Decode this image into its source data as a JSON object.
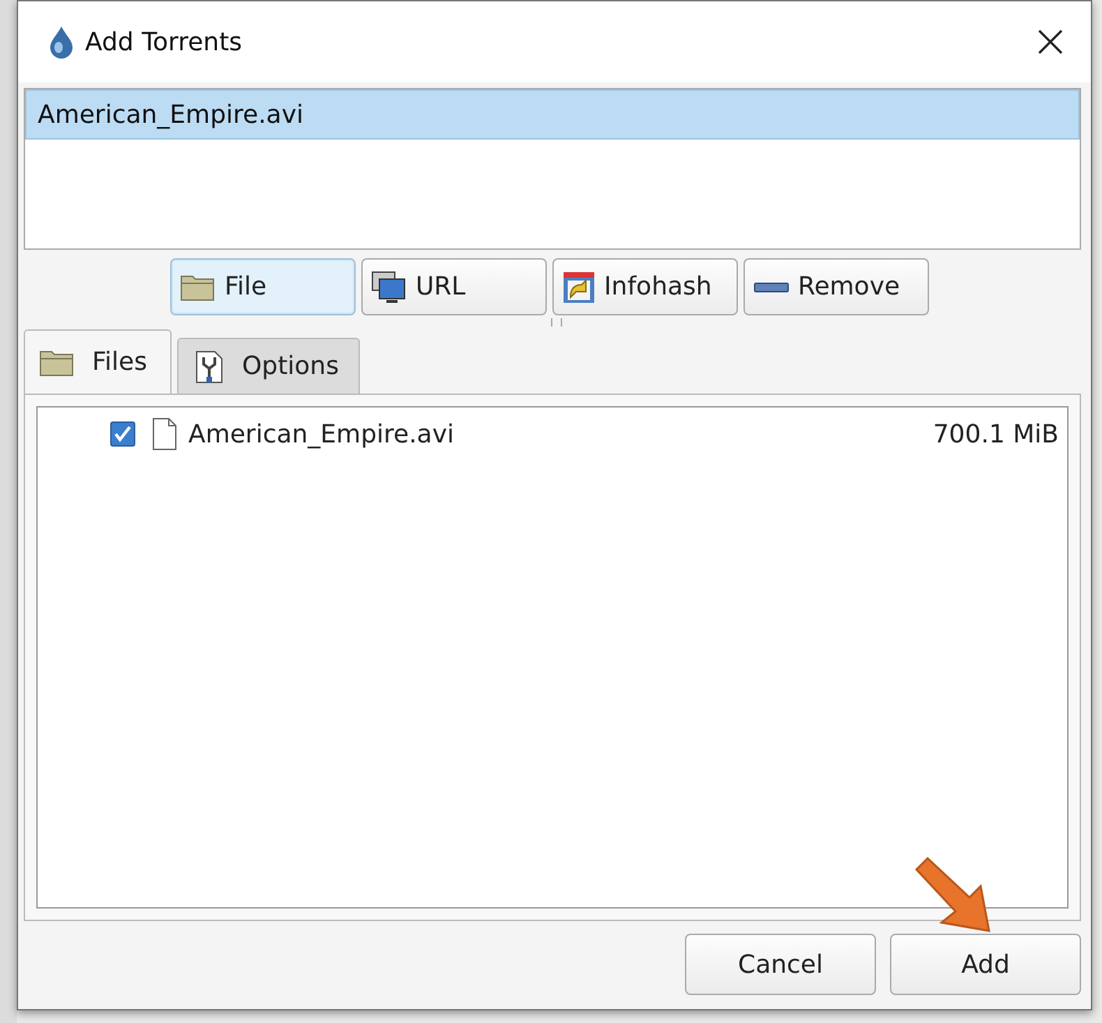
{
  "window": {
    "title": "Add Torrents"
  },
  "torrents": [
    {
      "name": "American_Empire.avi",
      "selected": true
    }
  ],
  "toolbar": [
    {
      "label": "File",
      "selected": true
    },
    {
      "label": "URL",
      "selected": false
    },
    {
      "label": "Infohash",
      "selected": false
    },
    {
      "label": "Remove",
      "selected": false
    }
  ],
  "tabs": [
    {
      "label": "Files",
      "selected": true
    },
    {
      "label": "Options",
      "selected": false
    }
  ],
  "files": [
    {
      "name": "American_Empire.avi",
      "size": "700.1 MiB",
      "checked": true
    }
  ],
  "buttons": [
    {
      "label": "Cancel"
    },
    {
      "label": "Add"
    }
  ]
}
